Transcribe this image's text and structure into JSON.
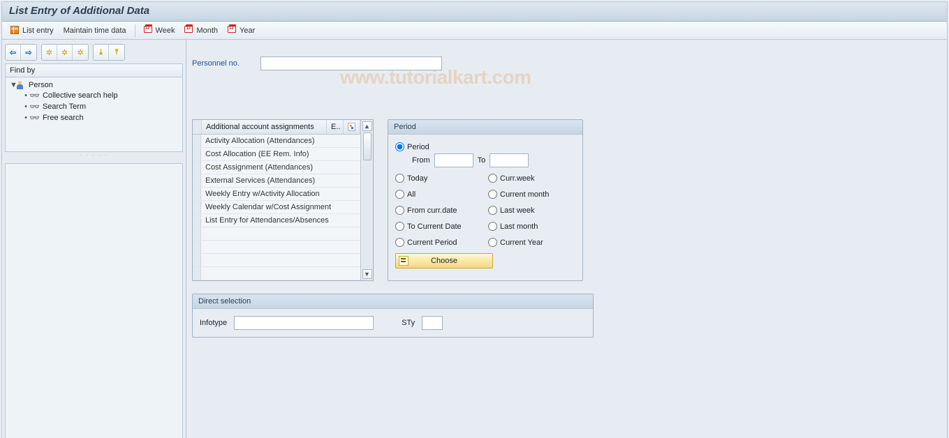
{
  "title": "List Entry of Additional Data",
  "toolbar": {
    "list_entry": "List entry",
    "maintain": "Maintain time data",
    "week": "Week",
    "month": "Month",
    "year": "Year"
  },
  "findby_label": "Find by",
  "tree": {
    "person": "Person",
    "collective": "Collective search help",
    "search_term": "Search Term",
    "free_search": "Free search"
  },
  "personnel_label": "Personnel no.",
  "personnel_value": "",
  "grid": {
    "header_main": "Additional account assignments",
    "header_e": "E..",
    "rows": [
      "Activity Allocation (Attendances)",
      "Cost Allocation (EE Rem. Info)",
      "Cost Assignment (Attendances)",
      "External Services (Attendances)",
      "Weekly Entry w/Activity Allocation",
      "Weekly Calendar w/Cost Assignment",
      "List Entry for Attendances/Absences"
    ]
  },
  "period": {
    "title": "Period",
    "period_radio": "Period",
    "from": "From",
    "to": "To",
    "from_val": "",
    "to_val": "",
    "today": "Today",
    "curr_week": "Curr.week",
    "all": "All",
    "current_month": "Current month",
    "from_curr": "From curr.date",
    "last_week": "Last week",
    "to_current": "To Current Date",
    "last_month": "Last month",
    "current_period": "Current Period",
    "current_year": "Current Year",
    "choose": "Choose"
  },
  "direct": {
    "title": "Direct selection",
    "infotype": "Infotype",
    "infotype_val": "",
    "sty": "STy",
    "sty_val": ""
  },
  "watermark": "www.tutorialkart.com"
}
